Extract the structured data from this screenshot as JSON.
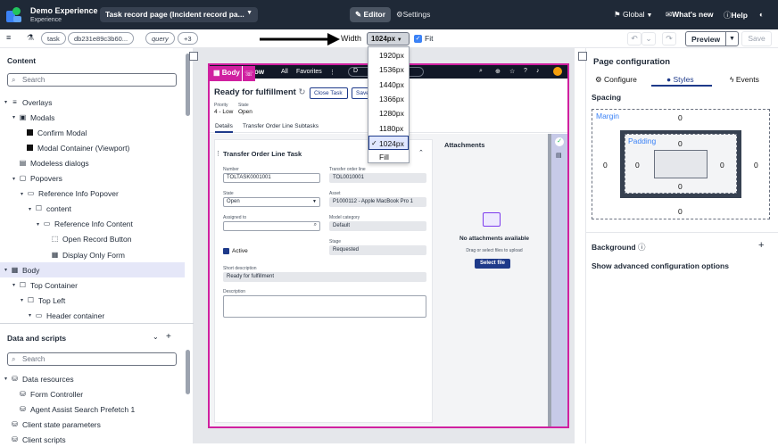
{
  "app": {
    "experience_name": "Demo Experience",
    "experience_sub": "Experience",
    "page_select": "Task record page (Incident record pa...",
    "mode_editor": "Editor",
    "mode_settings": "Settings",
    "scope": "Global",
    "whats_new": "What's new",
    "help": "Help"
  },
  "toolbar": {
    "pill_task": "task",
    "pill_sysid": "db231e89c3b60...",
    "pill_query": "query",
    "pill_more": "+3",
    "width_label": "Width",
    "width_value": "1024px",
    "fit_label": "Fit",
    "preview": "Preview",
    "save": "Save"
  },
  "width_options": [
    "1920px",
    "1536px",
    "1440px",
    "1366px",
    "1280px",
    "1180px",
    "1024px",
    "Fill"
  ],
  "width_selected": "1024px",
  "content_panel": {
    "title": "Content",
    "search_placeholder": "Search",
    "tree": [
      {
        "label": "Overlays",
        "depth": 0,
        "icon": "layers-icon",
        "twisty": "▾"
      },
      {
        "label": "Modals",
        "depth": 1,
        "icon": "modal-icon",
        "twisty": "▾"
      },
      {
        "label": "Confirm Modal",
        "depth": 2,
        "icon": "black-square-icon",
        "twisty": ""
      },
      {
        "label": "Modal Container (Viewport)",
        "depth": 2,
        "icon": "black-square-icon",
        "twisty": ""
      },
      {
        "label": "Modeless dialogs",
        "depth": 1,
        "icon": "dialog-icon",
        "twisty": ""
      },
      {
        "label": "Popovers",
        "depth": 1,
        "icon": "popover-icon",
        "twisty": "▾"
      },
      {
        "label": "Reference Info Popover",
        "depth": 2,
        "icon": "monitor-icon",
        "twisty": "▾"
      },
      {
        "label": "content",
        "depth": 3,
        "icon": "container-icon",
        "twisty": "▾"
      },
      {
        "label": "Reference Info Content",
        "depth": 4,
        "icon": "monitor-icon",
        "twisty": "▾"
      },
      {
        "label": "Open Record Button",
        "depth": 5,
        "icon": "button-icon",
        "twisty": ""
      },
      {
        "label": "Display Only Form",
        "depth": 5,
        "icon": "form-icon",
        "twisty": ""
      },
      {
        "label": "Body",
        "depth": 0,
        "icon": "grid-icon",
        "twisty": "▾"
      },
      {
        "label": "Top Container",
        "depth": 1,
        "icon": "container-icon",
        "twisty": "▾"
      },
      {
        "label": "Top Left",
        "depth": 2,
        "icon": "container-icon",
        "twisty": "▾"
      },
      {
        "label": "Header container",
        "depth": 3,
        "icon": "monitor-icon",
        "twisty": "▾"
      }
    ]
  },
  "data_panel": {
    "title": "Data and scripts",
    "search_placeholder": "Search",
    "tree": [
      {
        "label": "Data resources",
        "depth": 0,
        "twisty": "▾"
      },
      {
        "label": "Form Controller",
        "depth": 1,
        "twisty": ""
      },
      {
        "label": "Agent Assist Search Prefetch 1",
        "depth": 1,
        "twisty": ""
      },
      {
        "label": "Client state parameters",
        "depth": 0,
        "twisty": ""
      },
      {
        "label": "Client scripts",
        "depth": 0,
        "twisty": ""
      }
    ]
  },
  "preview": {
    "body_tag": "Body",
    "nav_brand": "ow",
    "nav_all": "All",
    "nav_favorites": "Favorites",
    "nav_more": "⋮",
    "nav_search_frag": "D",
    "record_title": "Ready for fulfillment",
    "close_task": "Close Task",
    "save": "Save",
    "priority_label": "Priority",
    "priority_value": "4 - Low",
    "state_label": "State",
    "state_value": "Open",
    "tab_details": "Details",
    "tab_subtasks": "Transfer Order Line Subtasks",
    "section_title": "Transfer Order Line Task",
    "number_label": "Number",
    "number_value": "TOLTASK0001001",
    "tol_label": "Transfer order line",
    "tol_value": "TOL0010001",
    "state_field_label": "State",
    "state_field_value": "Open",
    "asset_label": "Asset",
    "asset_value": "P1000112 - Apple MacBook Pro 1",
    "assigned_label": "Assigned to",
    "model_label": "Model category",
    "model_value": "Default",
    "active_label": "Active",
    "stage_label": "Stage",
    "stage_value": "Requested",
    "short_desc_label": "Short description",
    "short_desc_value": "Ready for fulfillment",
    "desc_label": "Description",
    "attachments_title": "Attachments",
    "no_attach": "No attachments available",
    "drag_text": "Drag or select files to upload",
    "select_file": "Select file"
  },
  "config_panel": {
    "title": "Page configuration",
    "tab_configure": "Configure",
    "tab_styles": "Styles",
    "tab_events": "Events",
    "spacing": "Spacing",
    "margin_label": "Margin",
    "padding_label": "Padding",
    "margin_top": "0",
    "margin_left": "0",
    "margin_right": "0",
    "margin_bottom": "0",
    "padding_top": "0",
    "padding_left": "0",
    "padding_right": "0",
    "padding_bottom": "0",
    "background": "Background",
    "advanced": "Show advanced configuration options"
  },
  "colors": {
    "topbar": "#1f2937",
    "accent": "#d020a0",
    "selected": "#e0e7ff"
  }
}
